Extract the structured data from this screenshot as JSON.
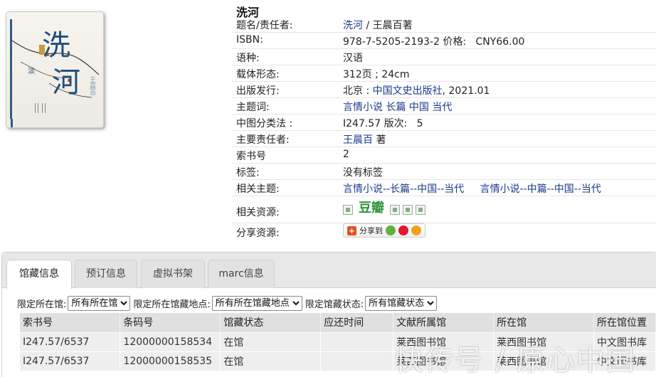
{
  "book": {
    "title": "洗河",
    "cover": {
      "title_chars": "洗河",
      "side_text": "王晨百"
    }
  },
  "fields": [
    {
      "label": "题名/责任者:",
      "parts": [
        {
          "text": "洗河",
          "link": true
        },
        {
          "text": " / 王晨百著",
          "link": false
        }
      ]
    },
    {
      "label": "ISBN:",
      "parts": [
        {
          "text": "978-7-5205-2193-2 价格:   CNY66.00",
          "link": false
        }
      ]
    },
    {
      "label": "语种:",
      "parts": [
        {
          "text": "汉语",
          "link": false
        }
      ]
    },
    {
      "label": "载体形态:",
      "parts": [
        {
          "text": "312页 ; 24cm",
          "link": false
        }
      ]
    },
    {
      "label": "出版发行:",
      "parts": [
        {
          "text": "北京 : ",
          "link": false
        },
        {
          "text": "中国文史出版社",
          "link": true
        },
        {
          "text": ", 2021.01",
          "link": false
        }
      ]
    },
    {
      "label": "主题词:",
      "parts": [
        {
          "text": "言情小说 长篇 中国 当代",
          "link": true
        }
      ]
    },
    {
      "label": "中图分类法 :",
      "parts": [
        {
          "text": "I247.57 版次:   5",
          "link": false
        }
      ]
    },
    {
      "label": "主要责任者:",
      "parts": [
        {
          "text": "王晨百",
          "link": true
        },
        {
          "text": " 著",
          "link": false
        }
      ]
    },
    {
      "label": "索书号",
      "parts": [
        {
          "text": "2",
          "link": false
        }
      ]
    },
    {
      "label": "标签:",
      "parts": [
        {
          "text": "没有标签",
          "link": false
        }
      ]
    },
    {
      "label": "相关主题:",
      "parts": [
        {
          "text": "言情小说--长篇--中国--当代",
          "link": true
        },
        {
          "text": "     ",
          "link": false
        },
        {
          "text": "言情小说--中篇--中国--当代",
          "link": true
        }
      ]
    }
  ],
  "resources": {
    "label": "相关资源:",
    "douban": "豆瓣"
  },
  "share": {
    "label": "分享资源:",
    "button": "分享到"
  },
  "tabs": [
    "馆藏信息",
    "预订信息",
    "虚拟书架",
    "marc信息"
  ],
  "filters": {
    "loc_label": "限定所在馆:",
    "loc_value": "所有所在馆",
    "place_label": "限定所在馆藏地点:",
    "place_value": "所有所在馆藏地点",
    "status_label": "限定馆藏状态:",
    "status_value": "所有馆藏状态"
  },
  "holdings": {
    "columns": [
      "索书号",
      "条码号",
      "馆藏状态",
      "应还时间",
      "文献所属馆",
      "所在馆",
      "所在馆位置"
    ],
    "rows": [
      [
        "I247.57/6537",
        "12000000158534",
        "在馆",
        "",
        "莱西图书馆",
        "莱西图书馆",
        "中文图书库"
      ],
      [
        "I247.57/6537",
        "12000000158535",
        "在馆",
        "",
        "莱西图书馆",
        "莱西图书馆",
        "中文图书库"
      ]
    ]
  },
  "watermark": "快传号 / 原心中国"
}
